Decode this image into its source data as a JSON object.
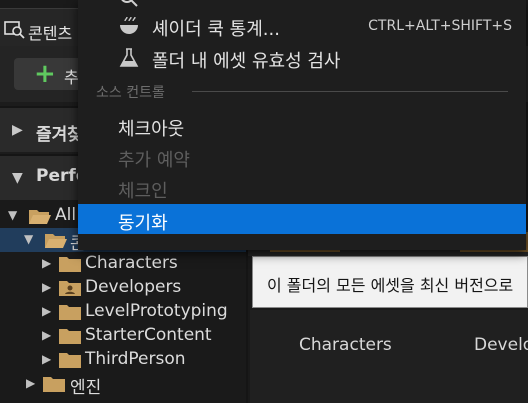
{
  "window_tab": {
    "label": "콘텐츠",
    "icon": "content-browser-icon"
  },
  "toolbar": {
    "add_label": "추",
    "add_icon": "plus-icon"
  },
  "sidebar": {
    "favorites_label": "즐겨찾",
    "performance_label": "Perfo"
  },
  "tree": {
    "all_label": "All",
    "content_label": "콘",
    "folders": [
      {
        "label": "Characters",
        "icon": "folder-icon"
      },
      {
        "label": "Developers",
        "icon": "developer-folder-icon"
      },
      {
        "label": "LevelPrototyping",
        "icon": "folder-icon"
      },
      {
        "label": "StarterContent",
        "icon": "folder-icon"
      },
      {
        "label": "ThirdPerson",
        "icon": "folder-icon"
      }
    ],
    "engine_label": "엔진"
  },
  "tooltip": {
    "text": "이 폴더의 모든 에셋을 최신 버전으로"
  },
  "tiles": [
    {
      "label": "Characters"
    },
    {
      "label": "Develo"
    }
  ],
  "menu": {
    "items": [
      {
        "label": "셰이더 쿡 통계...",
        "shortcut": "CTRL+ALT+SHIFT+S",
        "icon": "shader-cook-icon"
      },
      {
        "label": "폴더 내 에셋 유효성 검사",
        "icon": "flask-icon"
      }
    ],
    "section_label": "소스 컨트롤",
    "source_control_items": [
      {
        "label": "체크아웃",
        "enabled": true
      },
      {
        "label": "추가 예약",
        "enabled": false
      },
      {
        "label": "체크인",
        "enabled": false
      },
      {
        "label": "동기화",
        "enabled": true,
        "highlighted": true
      }
    ]
  },
  "colors": {
    "highlight": "#0a72d8",
    "selection": "#213d5c",
    "folder": "#c8a060",
    "add_green": "#5fc95f"
  }
}
